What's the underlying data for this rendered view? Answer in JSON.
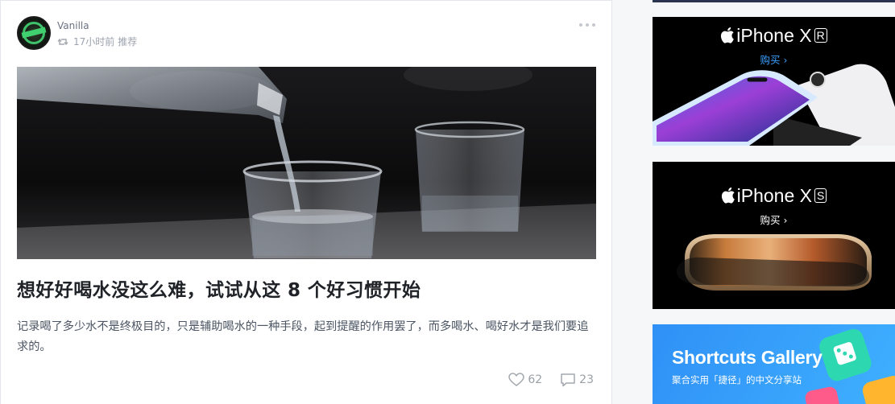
{
  "post": {
    "author": "Vanilla",
    "time": "17小时前",
    "tag": "推荐",
    "title": "想好好喝水没这么难，试试从这 8 个好习惯开始",
    "excerpt": "记录喝了多少水不是终极目的，只是辅助喝水的一种手段，起到提醒的作用罢了，而多喝水、喝好水才是我们要追求的。",
    "likes": "62",
    "comments": "23"
  },
  "ads": {
    "xr": {
      "product": "iPhone X",
      "badge": "R",
      "cta": "购买 ›",
      "cta_color": "#3aa0ff"
    },
    "xs": {
      "product": "iPhone X",
      "badge": "S",
      "cta": "购买 ›",
      "cta_color": "#ffffff"
    },
    "shortcuts": {
      "title": "Shortcuts Gallery",
      "subtitle": "聚合实用「捷径」的中文分享站"
    }
  },
  "icons": [
    "more-icon",
    "retweet-icon",
    "heart-icon",
    "comment-icon",
    "apple-logo-icon"
  ],
  "colors": {
    "accent": "#3aa0ff",
    "text": "#1f2328",
    "muted": "#9aa0a6"
  }
}
